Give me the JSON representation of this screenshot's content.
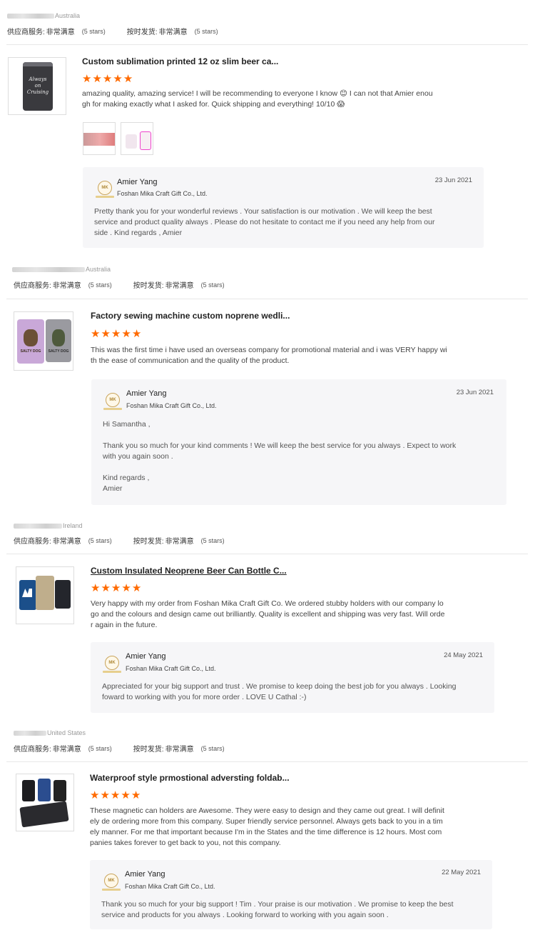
{
  "reviews": [
    {
      "country": "Australia",
      "supplier_service_label": "供应商服务:",
      "supplier_service_value": "非常满意",
      "supplier_service_stars": "(5 stars)",
      "delivery_label": "按时发货:",
      "delivery_value": "非常满意",
      "delivery_stars": "(5 stars)",
      "product_title": "Custom sublimation printed 12 oz slim beer ca...",
      "thumb_text": [
        "Always",
        "on",
        "Cruising"
      ],
      "rating": 5,
      "text_lines": [
        "amazing quality, amazing service! I will be recommending to everyone I know 😊 I can not that Amier enou",
        "gh for making exactly what I asked for. Quick shipping and everything! 10/10 😱"
      ],
      "reply": {
        "logo": "MK",
        "name": "Amier Yang",
        "company": "Foshan Mika Craft Gift Co., Ltd.",
        "date": "23 Jun 2021",
        "lines": [
          "Pretty thank you for your wonderful reviews . Your satisfaction is our motivation . We will keep the best",
          "service and product quality always . Please do not hesitate to contact me if you need any help from our",
          "side . Kind regards , Amier"
        ]
      }
    },
    {
      "country": "Australia",
      "supplier_service_label": "供应商服务:",
      "supplier_service_value": "非常满意",
      "supplier_service_stars": "(5 stars)",
      "delivery_label": "按时发货:",
      "delivery_value": "非常满意",
      "delivery_stars": "(5 stars)",
      "product_title": "Factory sewing machine custom noprene wedli...",
      "thumb_text": [
        "SALTY DOG",
        "SALTY DOG"
      ],
      "rating": 5,
      "text_lines": [
        "This was the first time i have used an overseas company for promotional material and i was VERY happy wi",
        "th the ease of communication and the quality of the product."
      ],
      "reply": {
        "logo": "MK",
        "name": "Amier Yang",
        "company": "Foshan Mika Craft Gift Co., Ltd.",
        "date": "23 Jun 2021",
        "lines": [
          "Hi Samantha ,",
          "",
          "Thank you so much for your kind comments ! We will keep the best service for you always . Expect to work",
          "with you again soon .",
          "",
          "Kind regards ,",
          "Amier"
        ]
      }
    },
    {
      "country": "Ireland",
      "supplier_service_label": "供应商服务:",
      "supplier_service_value": "非常满意",
      "supplier_service_stars": "(5 stars)",
      "delivery_label": "按时发货:",
      "delivery_value": "非常满意",
      "delivery_stars": "(5 stars)",
      "product_title": "Custom Insulated Neoprene Beer Can Bottle C...",
      "rating": 5,
      "text_lines": [
        "Very happy with my order from Foshan Mika Craft Gift Co. We ordered stubby holders with our company lo",
        "go and the colours and design came out brilliantly. Quality is excellent and shipping was very fast. Will orde",
        "r again in the future."
      ],
      "reply": {
        "logo": "MK",
        "name": "Amier Yang",
        "company": "Foshan Mika Craft Gift Co., Ltd.",
        "date": "24 May 2021",
        "lines": [
          "Appreciated for your big support and trust . We promise to keep doing the best job for you always . Looking",
          "foward to working with you for more order . LOVE U Cathal :-)"
        ]
      }
    },
    {
      "country": "United States",
      "supplier_service_label": "供应商服务:",
      "supplier_service_value": "非常满意",
      "supplier_service_stars": "(5 stars)",
      "delivery_label": "按时发货:",
      "delivery_value": "非常满意",
      "delivery_stars": "(5 stars)",
      "product_title": "Waterproof style prmostional adversting foldab...",
      "rating": 5,
      "text_lines": [
        "These magnetic can holders are Awesome. They were easy to design and they came out great. I will definit",
        "ely de ordering more from this company.  Super friendly service personnel. Always gets back to you in a tim",
        "ely manner. For me that important because I'm in the States and the time difference is 12 hours. Most com",
        "panies takes forever to get back to you, not this company."
      ],
      "reply": {
        "logo": "MK",
        "name": "Amier Yang",
        "company": "Foshan Mika Craft Gift Co., Ltd.",
        "date": "22 May 2021",
        "lines": [
          "Thank you so much for your big support  ! Tim . Your praise is our motivation . We promise to keep the best",
          "service and products for you always . Looking forward to working with you again soon ."
        ]
      }
    }
  ],
  "colors": {
    "star": "#ff6a00",
    "reply_bg": "#f6f6f8",
    "divider": "#e8e8e8"
  },
  "icons": {
    "star": "star-icon",
    "logo": "company-logo-icon"
  }
}
